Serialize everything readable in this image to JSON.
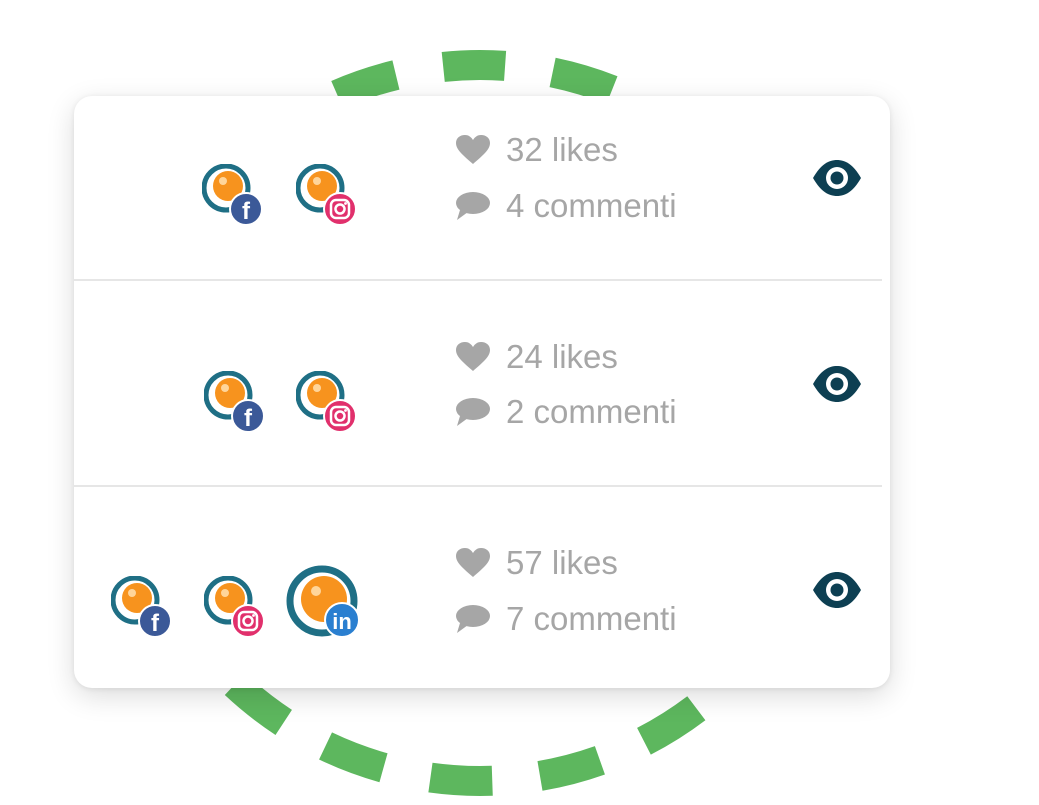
{
  "colors": {
    "ring": "#5db75e",
    "avatar_outer": "#1f6f85",
    "avatar_core": "#f7931e",
    "facebook": "#3b5998",
    "instagram": "#e1306c",
    "linkedin": "#2a7fd0",
    "stats_text": "#a6a6a6",
    "eye": "#0d3f52",
    "divider": "#e6e6e6"
  },
  "posts": [
    {
      "networks": [
        "facebook",
        "instagram"
      ],
      "likes": "32 likes",
      "comments": "4 commenti",
      "icons": {
        "likes": "heart-icon",
        "comments": "comment-icon",
        "view": "eye-icon"
      }
    },
    {
      "networks": [
        "facebook",
        "instagram"
      ],
      "likes": "24 likes",
      "comments": "2 commenti",
      "icons": {
        "likes": "heart-icon",
        "comments": "comment-icon",
        "view": "eye-icon"
      }
    },
    {
      "networks": [
        "facebook",
        "instagram",
        "linkedin"
      ],
      "likes": "57 likes",
      "comments": "7 commenti",
      "icons": {
        "likes": "heart-icon",
        "comments": "comment-icon",
        "view": "eye-icon"
      }
    }
  ]
}
